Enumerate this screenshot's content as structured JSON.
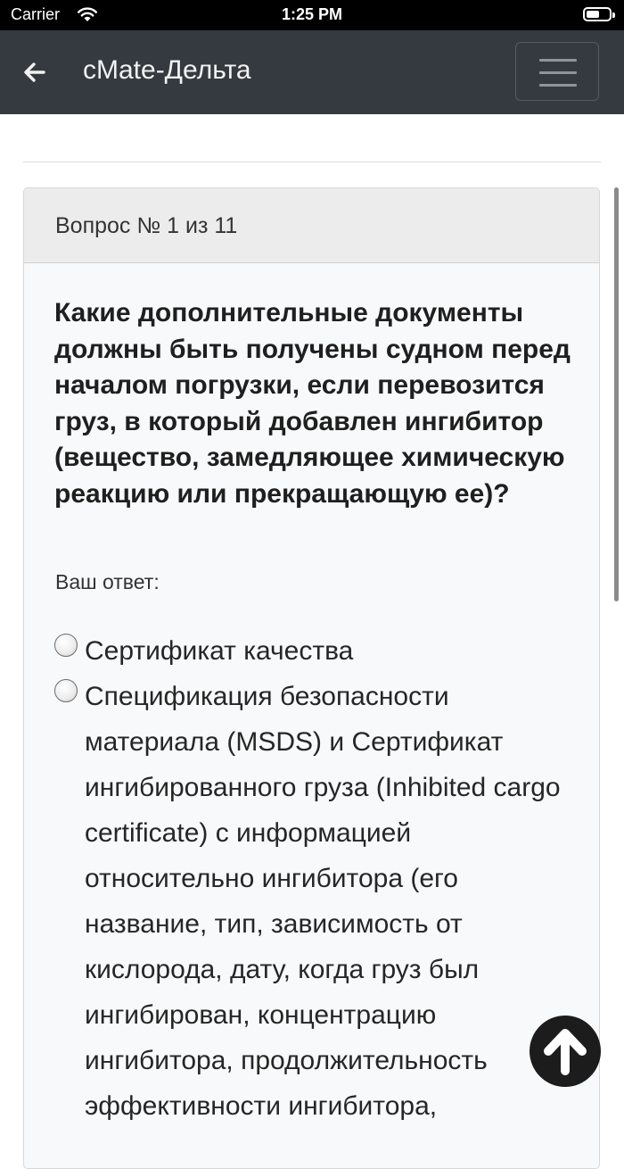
{
  "status_bar": {
    "carrier": "Carrier",
    "time": "1:25 PM"
  },
  "navbar": {
    "title": "cMate-Дельта",
    "back_icon": "arrow-left-icon",
    "menu_icon": "hamburger-icon"
  },
  "quiz": {
    "question_number": "Вопрос № 1 из 11",
    "question": "Какие дополнительные документы должны быть получены судном перед началом погрузки, если перевозится груз, в который добавлен ингибитор (вещество, замедляющее химическую реакцию или прекращающую ее)?",
    "answer_label": "Ваш ответ:",
    "options": [
      {
        "text": "Сертификат качества"
      },
      {
        "text": "Спецификация безопасности материала (MSDS) и Сертификат ингибированного груза (Inhibited cargo certificate) с информацией относительно ингибитора (его название, тип, зависимость от кислорода, дату, когда груз был ингибирован, концентрацию ингибитора, продолжительность эффективности ингибитора,"
      }
    ]
  },
  "scroll_top_icon": "arrow-up-icon",
  "colors": {
    "navbar": "#343a40",
    "status_bar": "#000000",
    "card_header": "#ececec",
    "card_body": "#f8f9fa"
  }
}
